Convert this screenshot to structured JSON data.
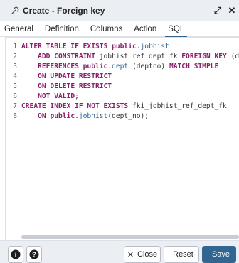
{
  "dialog": {
    "title": "Create - Foreign key",
    "maximize_glyph": "⤢",
    "close_glyph": "✕"
  },
  "tabs": [
    {
      "label": "General",
      "active": false
    },
    {
      "label": "Definition",
      "active": false
    },
    {
      "label": "Columns",
      "active": false
    },
    {
      "label": "Action",
      "active": false
    },
    {
      "label": "SQL",
      "active": true
    }
  ],
  "sql_lines": [
    {
      "n": "1",
      "tokens": [
        [
          "kw",
          "ALTER TABLE IF EXISTS "
        ],
        [
          "pub",
          "public"
        ],
        [
          "plain",
          "."
        ],
        [
          "ident",
          "jobhist"
        ]
      ]
    },
    {
      "n": "2",
      "tokens": [
        [
          "plain",
          "    "
        ],
        [
          "kw",
          "ADD CONSTRAINT "
        ],
        [
          "plain",
          "jobhist_ref_dept_fk "
        ],
        [
          "kw",
          "FOREIGN KEY "
        ],
        [
          "plain",
          "(dept_no)"
        ]
      ]
    },
    {
      "n": "3",
      "tokens": [
        [
          "plain",
          "    "
        ],
        [
          "kw",
          "REFERENCES "
        ],
        [
          "pub",
          "public"
        ],
        [
          "plain",
          "."
        ],
        [
          "ident",
          "dept"
        ],
        [
          "plain",
          " (deptno) "
        ],
        [
          "kw",
          "MATCH SIMPLE"
        ]
      ]
    },
    {
      "n": "4",
      "tokens": [
        [
          "plain",
          "    "
        ],
        [
          "kw",
          "ON UPDATE RESTRICT"
        ]
      ]
    },
    {
      "n": "5",
      "tokens": [
        [
          "plain",
          "    "
        ],
        [
          "kw",
          "ON DELETE RESTRICT"
        ]
      ]
    },
    {
      "n": "6",
      "tokens": [
        [
          "plain",
          "    "
        ],
        [
          "kw",
          "NOT VALID"
        ],
        [
          "plain",
          ";"
        ]
      ]
    },
    {
      "n": "7",
      "tokens": [
        [
          "kw",
          "CREATE INDEX IF NOT EXISTS "
        ],
        [
          "plain",
          "fki_jobhist_ref_dept_fk"
        ]
      ]
    },
    {
      "n": "8",
      "tokens": [
        [
          "plain",
          "    "
        ],
        [
          "kw",
          "ON "
        ],
        [
          "pub",
          "public"
        ],
        [
          "plain",
          "."
        ],
        [
          "ident",
          "jobhist"
        ],
        [
          "plain",
          "(dept_no);"
        ]
      ]
    }
  ],
  "footer": {
    "info_glyph": "i",
    "help_glyph": "?",
    "close_label": "Close",
    "reset_label": "Reset",
    "save_label": "Save"
  },
  "colors": {
    "accent": "#326690",
    "keyword": "#8a1f6d",
    "identifier": "#2f6496"
  }
}
